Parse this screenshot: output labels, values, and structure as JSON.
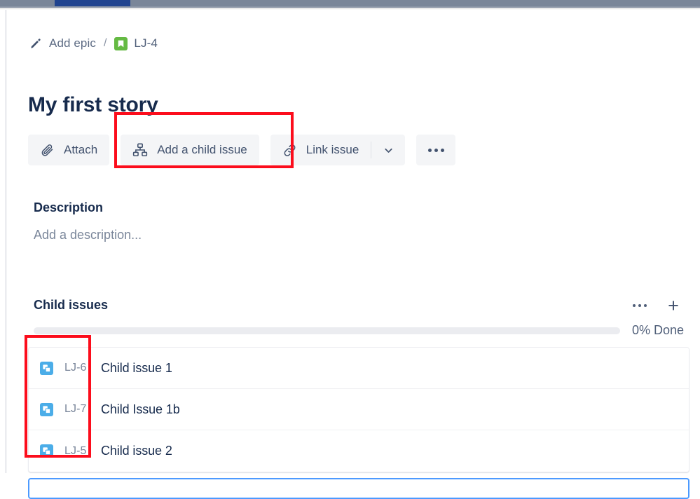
{
  "browser": {
    "active_tab_indicator": "active-tab"
  },
  "breadcrumb": {
    "epic_icon": "pencil-icon",
    "epic_label": "Add epic",
    "separator": "/",
    "issue_type_icon": "story-icon",
    "issue_key": "LJ-4"
  },
  "issue": {
    "title": "My first story"
  },
  "toolbar": {
    "attach": {
      "icon": "paperclip-icon",
      "label": "Attach"
    },
    "add_child": {
      "icon": "child-issue-icon",
      "label": "Add a child issue"
    },
    "link_issue": {
      "icon": "link-icon",
      "label": "Link issue"
    },
    "caret": "chevron-down-icon",
    "more": "more-actions-icon"
  },
  "description": {
    "heading": "Description",
    "placeholder": "Add a description..."
  },
  "child_issues": {
    "heading": "Child issues",
    "more_icon": "more-actions-icon",
    "add_icon": "plus-icon",
    "progress_percent": 0,
    "progress_label": "0% Done",
    "rows": [
      {
        "icon": "subtask-icon",
        "key": "LJ-6",
        "summary": "Child issue 1"
      },
      {
        "icon": "subtask-icon",
        "key": "LJ-7",
        "summary": "Child Issue 1b"
      },
      {
        "icon": "subtask-icon",
        "key": "LJ-5",
        "summary": "Child issue 2"
      }
    ]
  },
  "annotations": [
    {
      "name": "highlight-add-child-issue",
      "color": "#FC0D1C"
    },
    {
      "name": "highlight-child-issue-keys",
      "color": "#FC0D1C"
    }
  ],
  "colors": {
    "story_green": "#65BA43",
    "subtask_blue": "#4BADE8",
    "text_dark": "#172B4D",
    "text_muted": "#5E6C84",
    "button_bg": "#F4F5F7",
    "focus_blue": "#4C9AFF",
    "annotation_red": "#FC0D1C"
  }
}
